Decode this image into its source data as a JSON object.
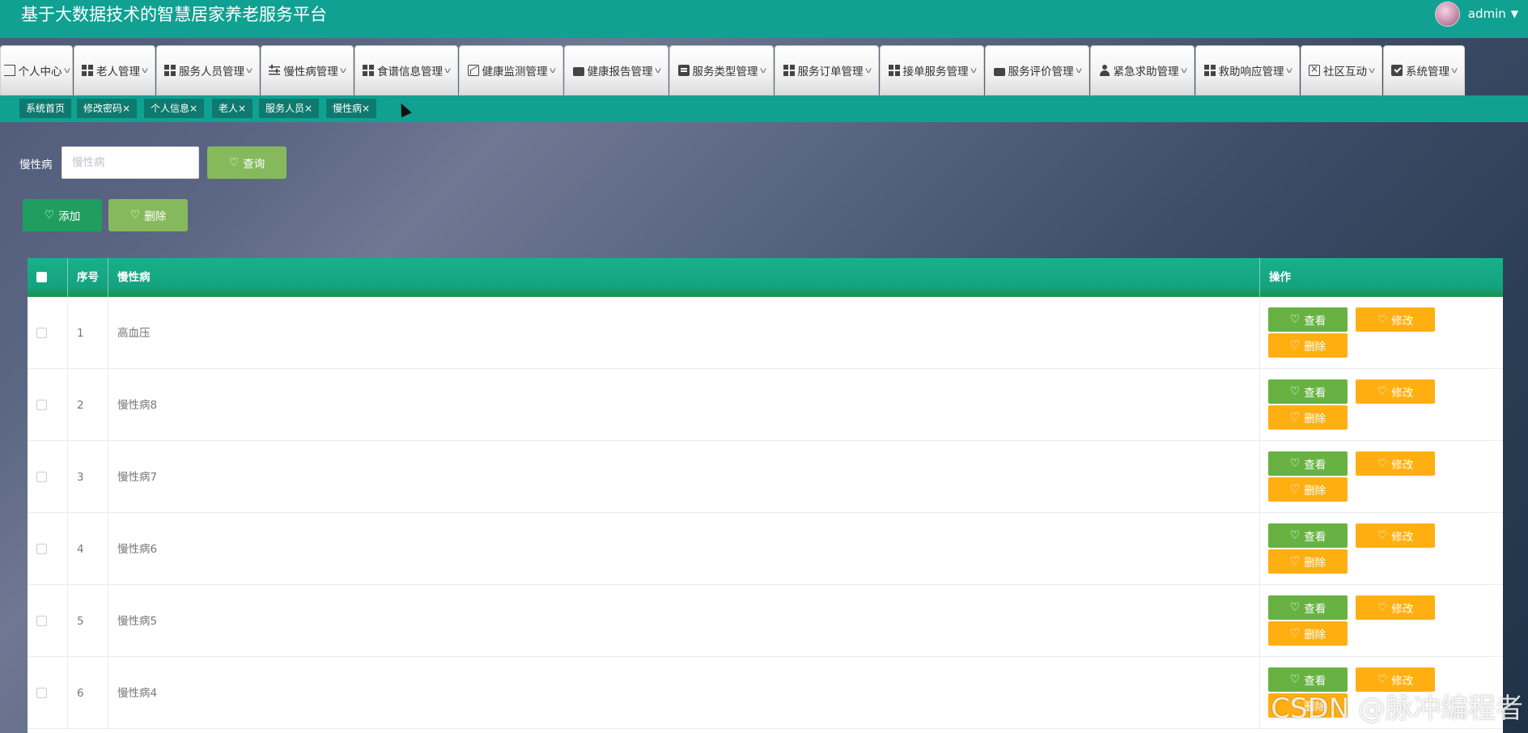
{
  "header": {
    "title": "基于大数据技术的智慧居家养老服务平台",
    "username": "admin"
  },
  "nav": {
    "items": [
      {
        "label": "个人中心",
        "icon": "list-icon"
      },
      {
        "label": "老人管理",
        "icon": "grid-icon"
      },
      {
        "label": "服务人员管理",
        "icon": "grid-icon"
      },
      {
        "label": "慢性病管理",
        "icon": "sliders-icon"
      },
      {
        "label": "食谱信息管理",
        "icon": "grid-icon"
      },
      {
        "label": "健康监测管理",
        "icon": "chart-icon"
      },
      {
        "label": "健康报告管理",
        "icon": "wallet-icon"
      },
      {
        "label": "服务类型管理",
        "icon": "clipboard-icon"
      },
      {
        "label": "服务订单管理",
        "icon": "grid-icon"
      },
      {
        "label": "接单服务管理",
        "icon": "grid-icon"
      },
      {
        "label": "服务评价管理",
        "icon": "briefcase-icon"
      },
      {
        "label": "紧急求助管理",
        "icon": "user-icon"
      },
      {
        "label": "救助响应管理",
        "icon": "grid-icon"
      },
      {
        "label": "社区互动",
        "icon": "box-x-icon"
      },
      {
        "label": "系统管理",
        "icon": "check-icon"
      }
    ]
  },
  "tabs": [
    {
      "label": "系统首页"
    },
    {
      "label": "修改密码×"
    },
    {
      "label": "个人信息×"
    },
    {
      "label": "老人×"
    },
    {
      "label": "服务人员×"
    },
    {
      "label": "慢性病×"
    }
  ],
  "search": {
    "label": "慢性病",
    "placeholder": "慢性病",
    "query_button": "查询"
  },
  "actions": {
    "add": "添加",
    "delete": "删除"
  },
  "table": {
    "columns": [
      "序号",
      "慢性病",
      "操作"
    ],
    "row_buttons": {
      "view": "查看",
      "edit": "修改",
      "delete": "删除"
    },
    "rows": [
      {
        "index": "1",
        "name": "高血压"
      },
      {
        "index": "2",
        "name": "慢性病8"
      },
      {
        "index": "3",
        "name": "慢性病7"
      },
      {
        "index": "4",
        "name": "慢性病6"
      },
      {
        "index": "5",
        "name": "慢性病5"
      },
      {
        "index": "6",
        "name": "慢性病4"
      }
    ]
  },
  "watermark": "CSDN @脉冲编程者",
  "colors": {
    "header": "#10a192",
    "tab_active": "#0e7a6f",
    "view_button": "#67b243",
    "edit_button": "#ffaf12",
    "add_button": "#1f9e5f",
    "query_button": "#86b95c"
  }
}
